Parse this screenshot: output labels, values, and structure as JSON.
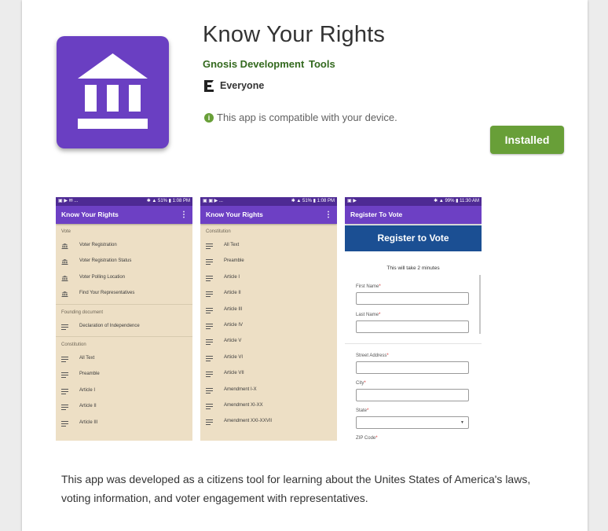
{
  "app": {
    "title": "Know Your Rights",
    "developer": "Gnosis Development",
    "category": "Tools",
    "content_rating": "Everyone",
    "compatibility": "This app is compatible with your device.",
    "install_label": "Installed",
    "description": "This app was developed as a citizens tool for learning about the Unites States of America's laws, voting information, and voter engagement with representatives.",
    "icon": "courthouse-icon",
    "accent_color": "#689f38",
    "icon_color": "#6a3fc2"
  },
  "screenshots": [
    {
      "status_left": "▣ ▶ ✉ ...",
      "status_right": "✱ ▲ 51% ▮ 1:08 PM",
      "appbar_title": "Know Your Rights",
      "sections": [
        {
          "heading": "Vote",
          "items": [
            {
              "label": "Voter Registration",
              "icon": "bank-icon"
            },
            {
              "label": "Voter Registration Status",
              "icon": "bank-icon"
            },
            {
              "label": "Voter Polling Location",
              "icon": "bank-icon"
            },
            {
              "label": "Find Your Representatives",
              "icon": "bank-icon"
            }
          ]
        },
        {
          "heading": "Founding document",
          "items": [
            {
              "label": "Declaration of Independence",
              "icon": "lines-icon"
            }
          ]
        },
        {
          "heading": "Constitution",
          "items": [
            {
              "label": "All Text",
              "icon": "lines-icon"
            },
            {
              "label": "Preamble",
              "icon": "lines-icon"
            },
            {
              "label": "Article I",
              "icon": "lines-icon"
            },
            {
              "label": "Article II",
              "icon": "lines-icon"
            },
            {
              "label": "Article III",
              "icon": "lines-icon"
            }
          ]
        }
      ]
    },
    {
      "status_left": "▣ ▣ ▶ ...",
      "status_right": "✱ ▲ 51% ▮ 1:08 PM",
      "appbar_title": "Know Your Rights",
      "sections": [
        {
          "heading": "Constitution",
          "items": [
            {
              "label": "All Text",
              "icon": "lines-icon"
            },
            {
              "label": "Preamble",
              "icon": "lines-icon"
            },
            {
              "label": "Article I",
              "icon": "lines-icon"
            },
            {
              "label": "Article II",
              "icon": "lines-icon"
            },
            {
              "label": "Article III",
              "icon": "lines-icon"
            },
            {
              "label": "Article IV",
              "icon": "lines-icon"
            },
            {
              "label": "Article V",
              "icon": "lines-icon"
            },
            {
              "label": "Article VI",
              "icon": "lines-icon"
            },
            {
              "label": "Article VII",
              "icon": "lines-icon"
            },
            {
              "label": "Amendment I-X",
              "icon": "lines-icon"
            },
            {
              "label": "Amendment XI-XX",
              "icon": "lines-icon"
            },
            {
              "label": "Amendment XXI-XXVII",
              "icon": "lines-icon"
            }
          ]
        }
      ]
    },
    {
      "status_left": "▣ ▶",
      "status_right": "✱ ▲ 99% ▮ 11:30 AM",
      "appbar_title": "Register To Vote",
      "banner": "Register to Vote",
      "note": "This will take 2 minutes",
      "fields": [
        {
          "label": "First Name",
          "type": "text"
        },
        {
          "label": "Last Name",
          "type": "text"
        },
        {
          "label": "Street Address",
          "type": "text"
        },
        {
          "label": "City",
          "type": "text"
        },
        {
          "label": "State",
          "type": "select"
        },
        {
          "label": "ZIP Code",
          "type": "text"
        }
      ]
    }
  ]
}
